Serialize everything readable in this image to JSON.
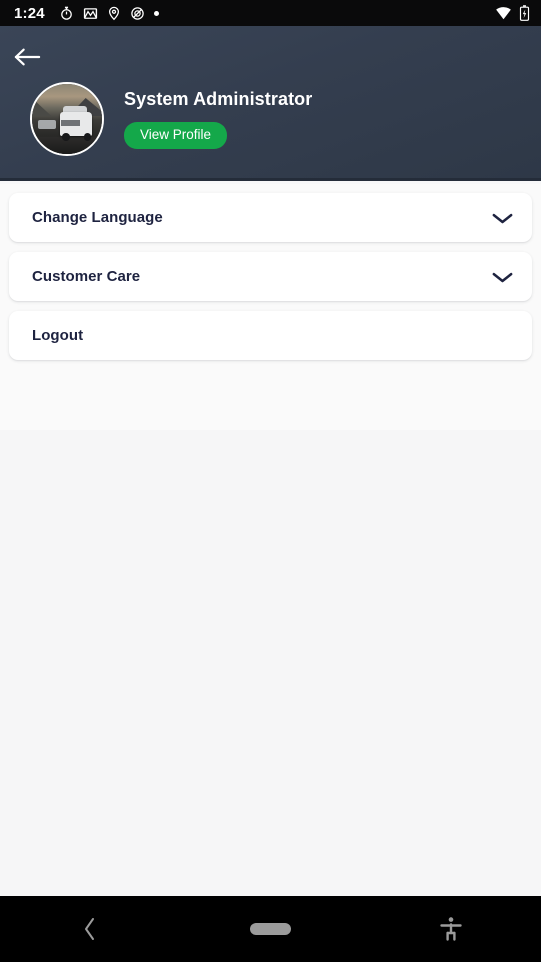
{
  "status_bar": {
    "time": "1:24",
    "left_icons": [
      "stopwatch-icon",
      "gmail-icon",
      "location-pin-icon",
      "dnd-icon",
      "notification-dot-icon"
    ],
    "right_icons": [
      "wifi-icon",
      "battery-charging-icon"
    ],
    "background_color": "#0A0A0B"
  },
  "header": {
    "back_button_icon": "arrow-left-icon",
    "avatar_alt": "profile-photo-vehicle",
    "profile_name": "System Administrator",
    "view_profile_label": "View Profile",
    "background_color": "#343E4F",
    "accent_color": "#14A84A"
  },
  "settings": {
    "items": [
      {
        "label": "Change Language",
        "has_chevron": true,
        "icon": "chevron-down-icon"
      },
      {
        "label": "Customer Care",
        "has_chevron": true,
        "icon": "chevron-down-icon"
      },
      {
        "label": "Logout",
        "has_chevron": false,
        "icon": ""
      }
    ]
  },
  "nav_bar": {
    "back_icon": "chevron-left-icon",
    "home_icon": "home-pill-icon",
    "accessibility_icon": "accessibility-icon",
    "background_color": "#000000"
  },
  "theme": {
    "page_background": "#F6F6F7",
    "card_background": "#FFFFFF",
    "text_dark": "#1E2340",
    "text_light": "#FFFFFF"
  }
}
